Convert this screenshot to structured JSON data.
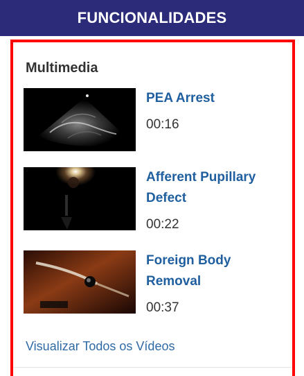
{
  "header": {
    "title": "FUNCIONALIDADES"
  },
  "multimedia": {
    "title": "Multimedia",
    "videos": [
      {
        "title": "PEA Arrest",
        "duration": "00:16",
        "thumbnail_icon": "ultrasound-thumbnail"
      },
      {
        "title": "Afferent Pupillary Defect",
        "duration": "00:22",
        "thumbnail_icon": "pupil-thumbnail"
      },
      {
        "title": "Foreign Body Removal",
        "duration": "00:37",
        "thumbnail_icon": "foreign-body-thumbnail"
      }
    ],
    "view_all_label": "Visualizar Todos os Vídeos"
  },
  "colors": {
    "header_bg": "#2b2b7a",
    "link": "#1f5f9f",
    "highlight_border": "#ff0000"
  }
}
